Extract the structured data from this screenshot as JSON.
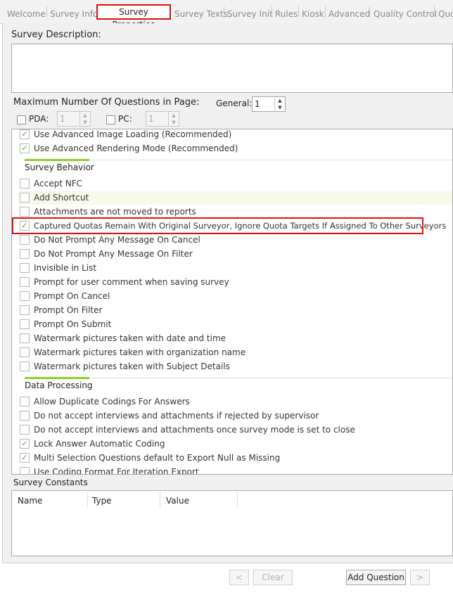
{
  "tabs": [
    "Welcome",
    "Survey Info",
    "Survey Properties",
    "Survey Texts",
    "Survey Init",
    "Rules",
    "Kiosk",
    "Advanced",
    "Quality Control",
    "Quo"
  ],
  "active_tab": "Survey Properties",
  "description_label": "Survey Description:",
  "max_questions_label": "Maximum Number Of Questions in Page:",
  "general_label": "General:",
  "general_value": "1",
  "pda_label": "PDA:",
  "pda_value": "1",
  "pc_label": "PC:",
  "pc_value": "1",
  "options_top": [
    {
      "label": "Use Advanced Image Loading (Recommended)",
      "checked": "✓"
    },
    {
      "label": "Use Advanced Rendering Mode (Recommended)",
      "checked": "✓"
    }
  ],
  "survey_behavior": {
    "title": "Survey Behavior",
    "items": [
      {
        "label": "Accept NFC",
        "checked": ""
      },
      {
        "label": "Add Shortcut",
        "checked": ""
      },
      {
        "label": "Attachments are not moved to reports",
        "checked": ""
      },
      {
        "label": "Captured Quotas Remain With Original Surveyor, Ignore Quota Targets If Assigned To Other Surveyors",
        "checked": "✓"
      },
      {
        "label": "Do Not Prompt Any Message On Cancel",
        "checked": ""
      },
      {
        "label": "Do Not Prompt Any Message On Filter",
        "checked": ""
      },
      {
        "label": "Invisible in List",
        "checked": ""
      },
      {
        "label": "Prompt for user comment when saving survey",
        "checked": ""
      },
      {
        "label": "Prompt On Cancel",
        "checked": ""
      },
      {
        "label": "Prompt On Filter",
        "checked": ""
      },
      {
        "label": "Prompt On Submit",
        "checked": ""
      },
      {
        "label": "Watermark pictures taken with date and time",
        "checked": ""
      },
      {
        "label": "Watermark pictures taken with organization name",
        "checked": ""
      },
      {
        "label": "Watermark pictures taken with Subject Details",
        "checked": ""
      }
    ]
  },
  "data_processing": {
    "title": "Data Processing",
    "items": [
      {
        "label": "Allow Duplicate Codings For Answers",
        "checked": ""
      },
      {
        "label": "Do not accept interviews and attachments if rejected by supervisor",
        "checked": ""
      },
      {
        "label": "Do not accept interviews and attachments once survey mode is set to close",
        "checked": ""
      },
      {
        "label": "Lock Answer Automatic Coding",
        "checked": "✓"
      },
      {
        "label": "Multi Selection Questions default to Export Null as Missing",
        "checked": "✓"
      },
      {
        "label": "Use Coding Format For Iteration Export",
        "checked": ""
      }
    ]
  },
  "constants": {
    "title": "Survey Constants",
    "columns": [
      "Name",
      "Type",
      "Value"
    ]
  },
  "buttons": {
    "prev": "<",
    "clear": "Clear",
    "add_question": "Add Question",
    "next": ">"
  }
}
